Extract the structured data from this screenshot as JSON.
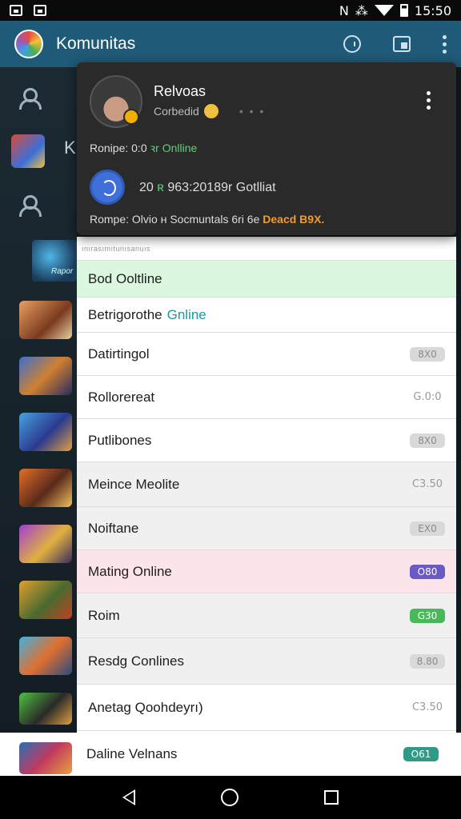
{
  "statusbar": {
    "time": "15:50",
    "icons_left": [
      "image-icon",
      "gallery-icon"
    ],
    "icons_right": [
      "nfc-icon",
      "vibrate-icon",
      "wifi-icon",
      "battery-icon"
    ]
  },
  "appbar": {
    "title": "Komunitas",
    "icons": [
      "chat-icon",
      "image-icon",
      "more-vert-icon"
    ]
  },
  "background": {
    "k_letter": "K",
    "rapor_label": "Rapor"
  },
  "popup": {
    "name": "Relvoas",
    "subtitle": "Corbedid",
    "dots": "• • •",
    "status_prefix": "Ronipe: 0:0 ",
    "status_online": "ꝛr Onlline",
    "stat_prefix": "20 ",
    "stat_mid": "ʀ",
    "stat_rest": " 963:20189r Gotlliat",
    "footer_prefix": "Rompe: Olvio ʜ Socmuntals 6ri 6e ",
    "footer_highlight": "Deacd B9X."
  },
  "list": {
    "header": "ınırasımıtunısanuıs",
    "rows": [
      {
        "label": "Bod Ooltline",
        "online": "",
        "value": "",
        "style": "none",
        "bg": "#dcf7e0",
        "height": 46
      },
      {
        "label": "Betrigorothe",
        "online": "Gnline",
        "value": "",
        "style": "none",
        "bg": "#ffffff",
        "height": 44
      },
      {
        "label": "Datirtingol",
        "online": "",
        "value": "8X0",
        "style": "grey",
        "bg": "#ffffff",
        "height": 54
      },
      {
        "label": "Rollorereat",
        "online": "",
        "value": "G.0:0",
        "style": "plain",
        "bg": "#ffffff",
        "height": 54
      },
      {
        "label": "Putlibones",
        "online": "",
        "value": "8X0",
        "style": "grey",
        "bg": "#ffffff",
        "height": 54
      },
      {
        "label": "Meince Meolite",
        "online": "",
        "value": "C3.50",
        "style": "plain",
        "bg": "#f0f0f0",
        "height": 56
      },
      {
        "label": "Noiftane",
        "online": "",
        "value": "EX0",
        "style": "grey",
        "bg": "#f0f0f0",
        "height": 54
      },
      {
        "label": "Mating Online",
        "online": "",
        "value": "O80",
        "style": "purple",
        "bg": "#fbe4ea",
        "height": 54
      },
      {
        "label": "Roim",
        "online": "",
        "value": "G30",
        "style": "green",
        "bg": "#f0f0f0",
        "height": 56
      },
      {
        "label": "Resdg Conlines",
        "online": "",
        "value": "8.80",
        "style": "grey",
        "bg": "#f0f0f0",
        "height": 58
      },
      {
        "label": "Anetag Qoohdeyrı)",
        "online": "",
        "value": "C3.50",
        "style": "plain",
        "bg": "#ffffff",
        "height": 58
      }
    ],
    "bottom": {
      "label": "Daline Velnans",
      "value": "O61",
      "style": "teal"
    }
  },
  "navbar": {
    "icons": [
      "back-icon",
      "home-icon",
      "recents-icon"
    ]
  }
}
